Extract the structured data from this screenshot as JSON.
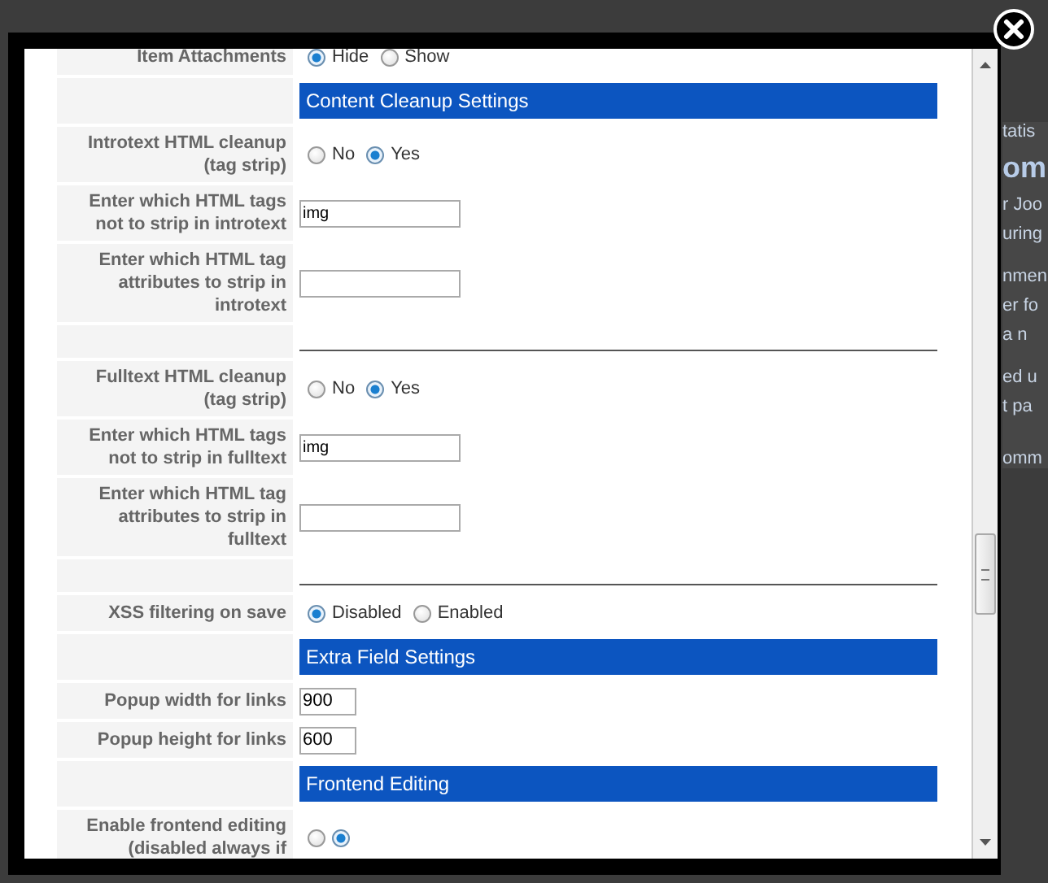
{
  "background_page": {
    "fragments": [
      "tatis",
      "om",
      "r Joo",
      "uring",
      "nmen",
      "er fo",
      "a n",
      "ed u",
      "t pa",
      "omm"
    ]
  },
  "modal": {
    "rows": [
      {
        "kind": "radio",
        "label": "Item Attachments",
        "options": [
          {
            "label": "Hide",
            "selected": true
          },
          {
            "label": "Show",
            "selected": false
          }
        ]
      },
      {
        "kind": "header",
        "title": "Content Cleanup Settings"
      },
      {
        "kind": "radio",
        "label": "Introtext HTML cleanup (tag strip)",
        "options": [
          {
            "label": "No",
            "selected": false
          },
          {
            "label": "Yes",
            "selected": true
          }
        ]
      },
      {
        "kind": "text",
        "label": "Enter which HTML tags not to strip in introtext",
        "value": "img"
      },
      {
        "kind": "text",
        "label": "Enter which HTML tag attributes to strip in introtext"
      },
      {
        "kind": "separator"
      },
      {
        "kind": "radio",
        "label": "Fulltext HTML cleanup (tag strip)",
        "options": [
          {
            "label": "No",
            "selected": false
          },
          {
            "label": "Yes",
            "selected": true
          }
        ]
      },
      {
        "kind": "text",
        "label": "Enter which HTML tags not to strip in fulltext",
        "value": "img"
      },
      {
        "kind": "text",
        "label": "Enter which HTML tag attributes to strip in fulltext"
      },
      {
        "kind": "separator"
      },
      {
        "kind": "radio",
        "label": "XSS filtering on save",
        "options": [
          {
            "label": "Disabled",
            "selected": true
          },
          {
            "label": "Enabled",
            "selected": false
          }
        ]
      },
      {
        "kind": "header",
        "title": "Extra Field Settings"
      },
      {
        "kind": "number",
        "label": "Popup width for links",
        "value": "900"
      },
      {
        "kind": "number",
        "label": "Popup height for links",
        "value": "600"
      },
      {
        "kind": "header",
        "title": "Frontend Editing"
      },
      {
        "kind": "radio",
        "label": "Enable frontend editing (disabled always if",
        "options": [
          {
            "selected": false
          },
          {
            "selected": true
          }
        ]
      }
    ]
  }
}
